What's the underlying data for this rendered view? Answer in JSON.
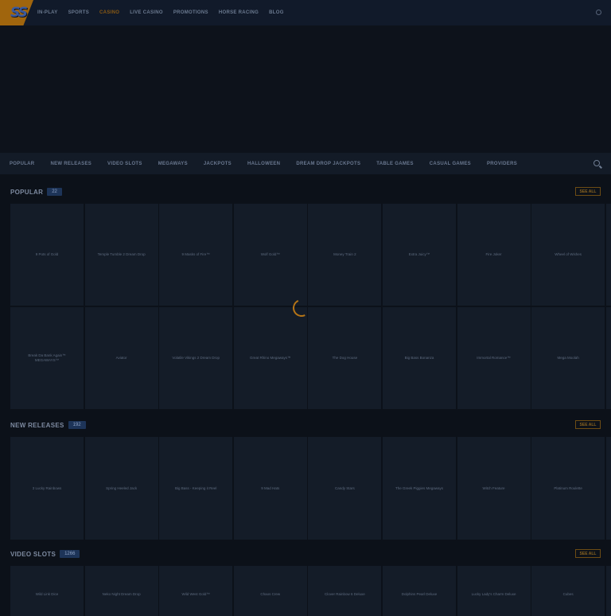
{
  "topnav": {
    "logo": "SS",
    "items": [
      "IN-PLAY",
      "SPORTS",
      "CASINO",
      "LIVE CASINO",
      "PROMOTIONS",
      "HORSE RACING",
      "BLOG"
    ],
    "active": "CASINO"
  },
  "categories": [
    "POPULAR",
    "NEW RELEASES",
    "VIDEO SLOTS",
    "MEGAWAYS",
    "JACKPOTS",
    "HALLOWEEN",
    "DREAM DROP JACKPOTS",
    "TABLE GAMES",
    "CASUAL GAMES",
    "PROVIDERS"
  ],
  "sections": [
    {
      "title": "POPULAR",
      "count": "22",
      "see_all": "SEE ALL",
      "rows": [
        [
          "9 Pots of Gold",
          "Temple Tumble 2 Dream Drop",
          "9 Masks of Fire™",
          "Wolf Gold™",
          "Money Train 2",
          "Extra Juicy™",
          "Fire Joker",
          "Wheel of Wishes"
        ],
        [
          "Break Da Bank Again™ MEGAWAYS™",
          "Aviator",
          "Volatile Vikings 2 Dream Drop",
          "Great Rhino Megaways™",
          "The Dog House",
          "Big Bass Bonanza",
          "Immortal Romance™",
          "Mega Moolah"
        ]
      ]
    },
    {
      "title": "NEW RELEASES",
      "count": "192",
      "see_all": "SEE ALL",
      "rows": [
        [
          "3 Lucky Rainbows",
          "Spring Heeled Jack",
          "Big Bass - Keeping it Reel",
          "9 Mad Hats",
          "Candy Stars",
          "The Greek Piggies Megaways",
          "Witch Feature",
          "Platinum Roulette"
        ]
      ]
    },
    {
      "title": "VIDEO SLOTS",
      "count": "1266",
      "see_all": "SEE ALL",
      "rows": [
        [
          "Wild Link Dice",
          "Neko Night Dream Drop",
          "Wild West Gold™",
          "Chaos Crew",
          "Clover Rainbow 6 Deluxe",
          "Dolphins Pearl Deluxe",
          "Lucky Lady's Charm Deluxe",
          "Cubes"
        ]
      ]
    }
  ],
  "colors": {
    "accent": "#b57416",
    "background": "#0c1119",
    "tile": "#141c28",
    "badge": "#1d3458"
  }
}
